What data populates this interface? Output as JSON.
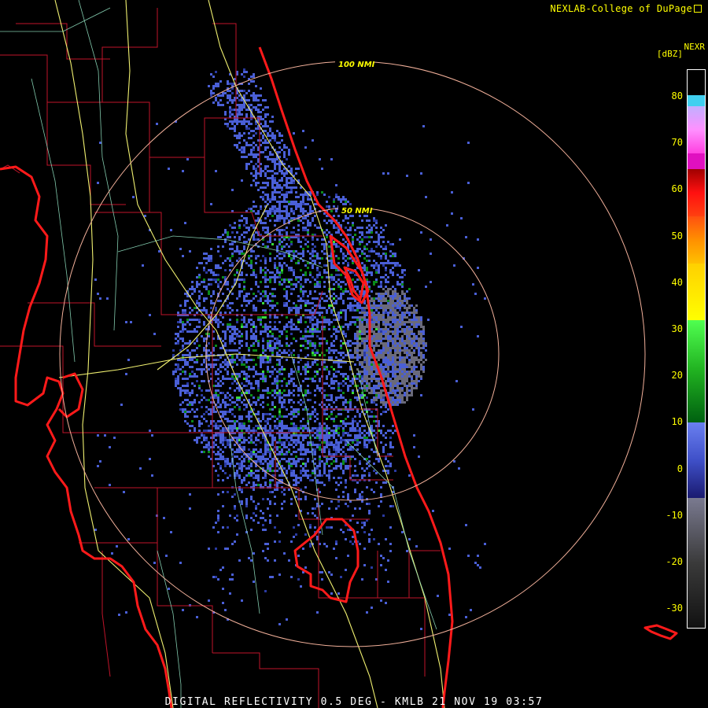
{
  "header": {
    "credit": "NEXLAB-College of DuPage"
  },
  "legend": {
    "product": "NEXR",
    "units": "[dBZ]",
    "ticks": [
      "80",
      "70",
      "60",
      "50",
      "40",
      "30",
      "20",
      "10",
      "0",
      "-10",
      "-20",
      "-30"
    ],
    "colors": {
      "gray_dark": "#2b2b2b",
      "gray_light": "#6a6a7a",
      "blue": "#4a5fd6",
      "blue_dark": "#2a3aa0",
      "green_dark": "#0a8a1a",
      "green": "#3adc3a",
      "yellow": "#ffff00",
      "orange": "#ff8a00",
      "red": "#ff1010",
      "magenta": "#ff20d0",
      "pink": "#ffa0ff",
      "cyan": "#40d0f0"
    }
  },
  "map": {
    "range_rings": [
      {
        "label": "100 NMI"
      },
      {
        "label": "50 NMI"
      }
    ],
    "colors": {
      "coast": "#ff1a1a",
      "county": "#c0142a",
      "highway": "#f0f070",
      "road": "#90e0c0",
      "ring": "#f2b09a"
    }
  },
  "footer": {
    "caption": "DIGITAL REFLECTIVITY 0.5 DEG - KMLB 21 NOV 19 03:57"
  }
}
